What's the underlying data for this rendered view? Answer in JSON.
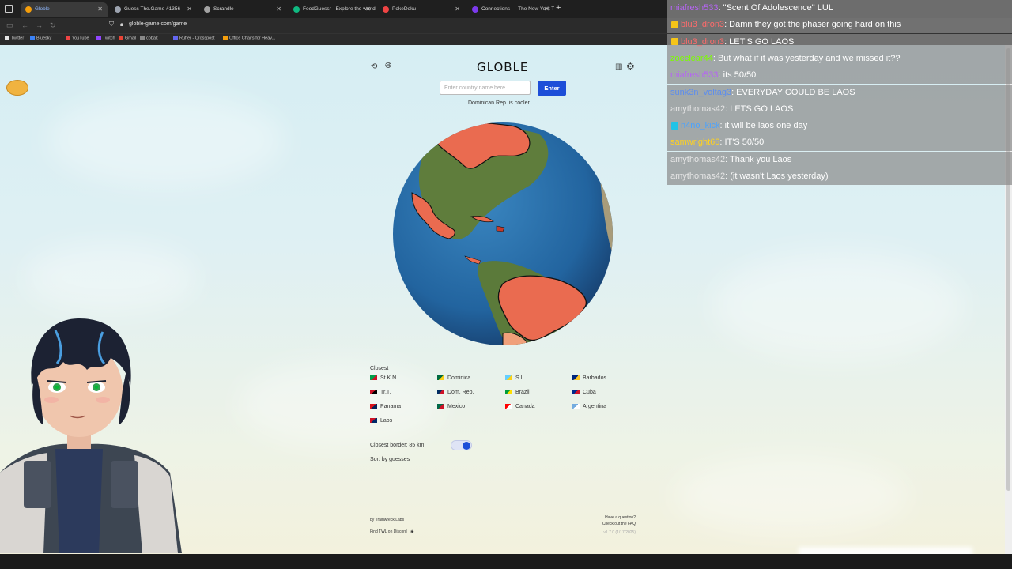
{
  "browser": {
    "tabs": [
      {
        "title": "Globle",
        "active": true,
        "color": "#f59e0b"
      },
      {
        "title": "Guess The.Game #1356",
        "active": false,
        "color": "#9ca3af"
      },
      {
        "title": "Scrandle",
        "active": false,
        "color": "#a3a3a3"
      },
      {
        "title": "FoodGuessr - Explore the world",
        "active": false,
        "color": "#10b981"
      },
      {
        "title": "PokeDoku",
        "active": false,
        "color": "#ef4444"
      },
      {
        "title": "Connections — The New York T",
        "active": false,
        "color": "#7c3aed"
      }
    ],
    "url": "globle-game.com/game",
    "bookmarks": [
      {
        "label": "Twitter",
        "color": "#e5e5e5"
      },
      {
        "label": "Bluesky",
        "color": "#3b82f6"
      },
      {
        "label": "YouTube",
        "color": "#ef4444"
      },
      {
        "label": "Twitch",
        "color": "#9146ff"
      },
      {
        "label": "Gmail",
        "color": "#ea4335"
      },
      {
        "label": "cobalt",
        "color": "#888888"
      },
      {
        "label": "Ruffer - Crosspost",
        "color": "#6366f1"
      },
      {
        "label": "Office Chairs for Heav...",
        "color": "#f59e0b"
      }
    ]
  },
  "game": {
    "title": "GLOBLE",
    "input_placeholder": "Enter country name here",
    "enter_label": "Enter",
    "hint": "Dominican Rep. is cooler",
    "closest_header": "Closest",
    "guesses": [
      {
        "name": "St.K.N.",
        "flag": [
          "#009e49",
          "#ce1126"
        ]
      },
      {
        "name": "Dominica",
        "flag": [
          "#006b3f",
          "#fcd116"
        ]
      },
      {
        "name": "S.L.",
        "flag": [
          "#65cfff",
          "#fcd116"
        ]
      },
      {
        "name": "Barbados",
        "flag": [
          "#00267f",
          "#ffc726"
        ]
      },
      {
        "name": "Tr.T.",
        "flag": [
          "#ce1126",
          "#000000"
        ]
      },
      {
        "name": "Dom. Rep.",
        "flag": [
          "#002d62",
          "#ce1126"
        ]
      },
      {
        "name": "Brazil",
        "flag": [
          "#009c3b",
          "#ffdf00"
        ]
      },
      {
        "name": "Cuba",
        "flag": [
          "#002a8f",
          "#cf142b"
        ]
      },
      {
        "name": "Panama",
        "flag": [
          "#da121a",
          "#072357"
        ]
      },
      {
        "name": "Mexico",
        "flag": [
          "#006847",
          "#ce1126"
        ]
      },
      {
        "name": "Canada",
        "flag": [
          "#ff0000",
          "#ffffff"
        ]
      },
      {
        "name": "Argentina",
        "flag": [
          "#74acdf",
          "#ffffff"
        ]
      },
      {
        "name": "Laos",
        "flag": [
          "#ce1126",
          "#002868"
        ]
      }
    ],
    "closest_border": "Closest border: 85  km",
    "sort_label": "Sort by guesses",
    "toggle_on": true,
    "footer_left_1": "by Trainwreck Labs",
    "footer_left_2": "Find TWL on Discord",
    "footer_right_1": "Have a question?",
    "footer_right_2": "Check out the FAQ",
    "footer_version": "v1.7.0 (1/17/2025)",
    "accent": "#1d4ed8",
    "guessed_color": "#ea6b50"
  },
  "chat": [
    {
      "user": "miafresh533",
      "color": "#b565f2",
      "badge": null,
      "message": ": \"Scent Of Adolescence\" LUL"
    },
    {
      "user": "blu3_dron3",
      "color": "#ff6b6b",
      "badge": "#f5c518",
      "message": ": Damn they got the phaser going hard on this"
    },
    {
      "user": "blu3_dron3",
      "color": "#ff6b6b",
      "badge": "#f5c518",
      "message": ": LET'S GO LAOS"
    },
    {
      "user": "zoeclear44",
      "color": "#7cfc00",
      "badge": null,
      "message": ": But what if it was yesterday and we missed it??"
    },
    {
      "user": "miafresh533",
      "color": "#b565f2",
      "badge": null,
      "message": ": its 50/50"
    },
    {
      "user": "sunk3n_voltag3",
      "color": "#5b8def",
      "badge": null,
      "message": ": EVERYDAY COULD BE LAOS"
    },
    {
      "user": "amythomas42",
      "color": "#e6e6e6",
      "badge": null,
      "message": ": LETS GO LAOS"
    },
    {
      "user": "n4no_kick",
      "color": "#4aa3ff",
      "badge": "#22c3e6",
      "message": ": it will be laos one day"
    },
    {
      "user": "samwright66",
      "color": "#ffd21f",
      "badge": null,
      "message": ": IT'S 50/50"
    },
    {
      "user": "amythomas42",
      "color": "#e6e6e6",
      "badge": null,
      "message": ": Thank you Laos"
    },
    {
      "user": "amythomas42",
      "color": "#e6e6e6",
      "badge": null,
      "message": ": (it wasn't Laos yesterday)"
    }
  ],
  "icons": [
    "refresh-icon",
    "globe-icon",
    "stats-icon",
    "settings-icon",
    "discord-icon"
  ]
}
